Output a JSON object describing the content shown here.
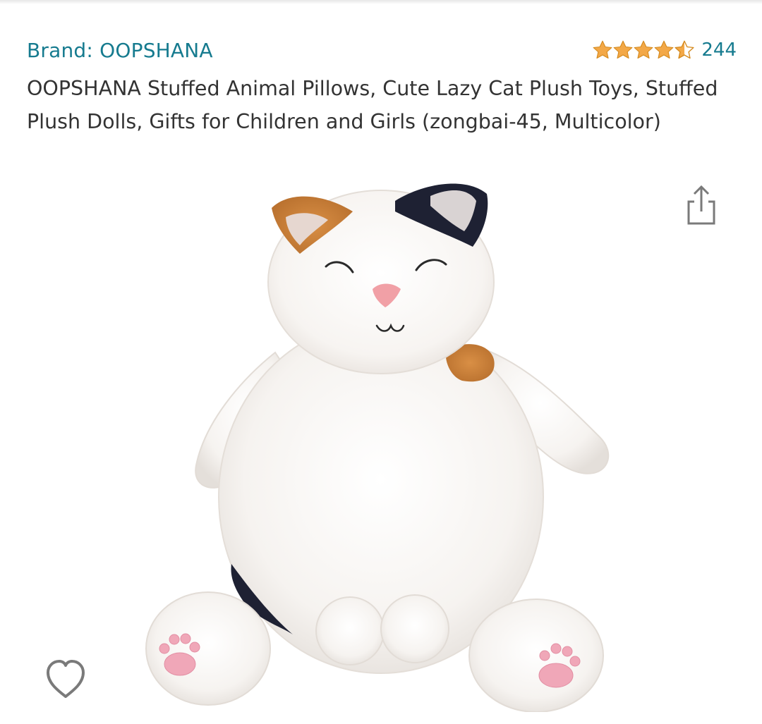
{
  "product": {
    "brand_label": "Brand: OOPSHANA",
    "rating": {
      "value": 4.5,
      "max": 5,
      "count": "244"
    },
    "title": "OOPSHANA Stuffed Animal Pillows, Cute Lazy Cat Plush Toys, Stuffed Plush Dolls, Gifts for Children and Girls (zongbai-45, Multicolor)"
  },
  "icons": {
    "share": "share-icon",
    "wishlist": "heart-icon",
    "star": "star-icon"
  },
  "colors": {
    "link": "#167b8f",
    "star": "#f3a847",
    "title_text": "#333333",
    "icon_gray": "#7a7a7a"
  }
}
